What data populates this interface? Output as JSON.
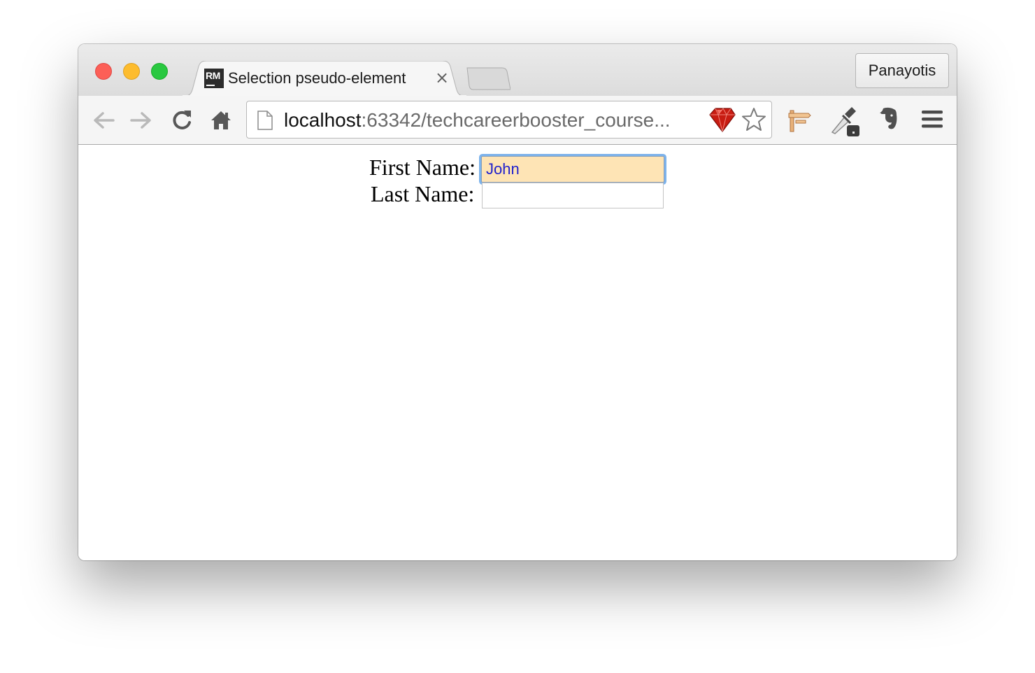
{
  "browser": {
    "tab": {
      "favicon_text": "RM",
      "title": "Selection pseudo-element",
      "close_glyph": "×"
    },
    "profile_name": "Panayotis",
    "address_bar": {
      "host": "localhost",
      "rest": ":63342/techcareerbooster_course..."
    },
    "icons": {
      "back": "back-arrow-icon",
      "forward": "forward-arrow-icon",
      "reload": "reload-icon",
      "home": "home-icon",
      "page": "page-icon",
      "ruby_extension": "ruby-gem-icon",
      "bookmark": "star-icon",
      "extension_1": "signpost-icon",
      "extension_2": "eyedropper-icon",
      "extension_3": "evernote-elephant-icon",
      "menu": "hamburger-menu-icon"
    }
  },
  "page": {
    "first_name_label": "First Name:",
    "first_name_value": "John",
    "last_name_label": "Last Name:",
    "last_name_value": ""
  },
  "colors": {
    "focused_field_bg": "#fee4b5",
    "focus_ring": "#7db3ec",
    "typed_text": "#2222cc"
  }
}
